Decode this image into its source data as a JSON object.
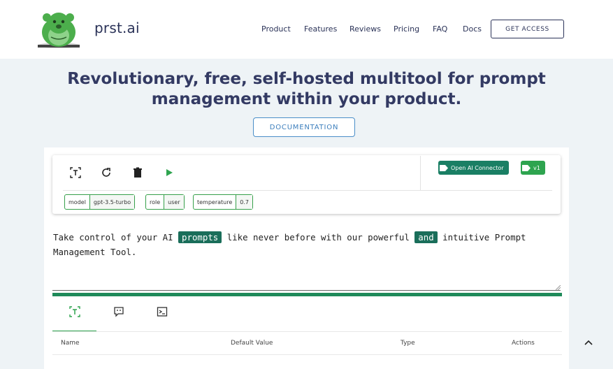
{
  "brand": {
    "name": "prst.ai"
  },
  "nav": {
    "items": [
      "Product",
      "Features",
      "Reviews",
      "Pricing",
      "FAQ",
      "Docs"
    ],
    "cta": "GET ACCESS"
  },
  "hero": {
    "title_line1": "Revolutionary, free, self-hosted multitool for prompt",
    "title_line2": "management within your product.",
    "doc_button": "DOCUMENTATION"
  },
  "toolbar": {
    "icons": [
      "text-variable-icon",
      "refresh-icon",
      "trash-icon",
      "play-icon"
    ],
    "connector_label": "Open AI Connector",
    "version_label": "v1"
  },
  "params": [
    {
      "key": "model",
      "value": "gpt-3.5-turbo"
    },
    {
      "key": "role",
      "value": "user"
    },
    {
      "key": "temperature",
      "value": "0.7"
    }
  ],
  "editor": {
    "part1": "Take control of your AI ",
    "hl1": "prompts",
    "part2": " like never before with our powerful ",
    "hl2": "and",
    "part3": " intuitive Prompt",
    "line2": "Management Tool."
  },
  "tabs": [
    "variables-tab",
    "comments-tab",
    "console-tab"
  ],
  "table": {
    "headers": {
      "name": "Name",
      "default": "Default Value",
      "type": "Type",
      "actions": "Actions"
    }
  },
  "colors": {
    "accent": "#1a7f64",
    "green": "#2ea44f",
    "navy": "#2b3358"
  }
}
